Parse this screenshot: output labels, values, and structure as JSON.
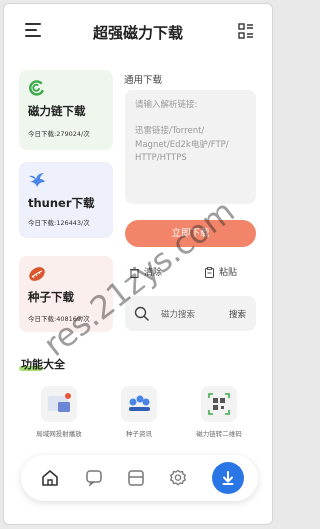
{
  "header": {
    "title": "超强磁力下载"
  },
  "cards": [
    {
      "name": "磁力链下载",
      "count": "今日下载:279024/次"
    },
    {
      "name": "thuner下载",
      "count": "今日下载:126443/次"
    },
    {
      "name": "种子下载",
      "count": "今日下载:408169/次"
    }
  ],
  "general": {
    "label": "通用下载",
    "placeholder_lines": [
      "请输入解析链接:",
      "",
      "迅雷链接/Torrent/",
      "Magnet/Ed2k电驴/FTP/",
      "HTTP/HTTPS"
    ],
    "download_button": "立即下载",
    "clear": "清除",
    "paste": "粘贴"
  },
  "search": {
    "placeholder": "磁力搜索",
    "button": "搜索"
  },
  "features": {
    "title": "功能大全",
    "items": [
      {
        "label": "局域网投射播放"
      },
      {
        "label": "种子资讯"
      },
      {
        "label": "磁力链转二维码"
      }
    ]
  },
  "watermark": "res.21zys.com",
  "colors": {
    "accent": "#f28469",
    "nav_primary": "#2a76e6",
    "card_magnet_bg": "#eef6ee",
    "card_thunder_bg": "#eef1fb",
    "card_seed_bg": "#fbefed"
  }
}
